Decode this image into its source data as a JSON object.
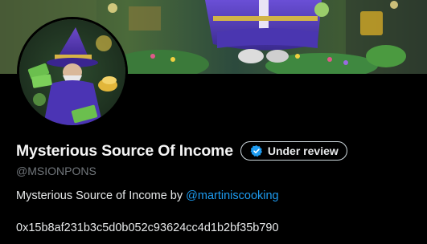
{
  "profile": {
    "name": "Mysterious Source Of Income",
    "badge_label": "Under review",
    "badge_icon": "verified-check-icon",
    "handle": "@MSIONPONS",
    "bio_text": "Mysterious Source of Income by ",
    "bio_mention": "@martiniscooking",
    "wallet_address": "0x15b8af231b3c5d0b052c93624cc4d1b2bf35b790"
  },
  "colors": {
    "background": "#000000",
    "link": "#1d9bf0",
    "handle": "#71767b",
    "badge_check": "#1d9bf0"
  }
}
